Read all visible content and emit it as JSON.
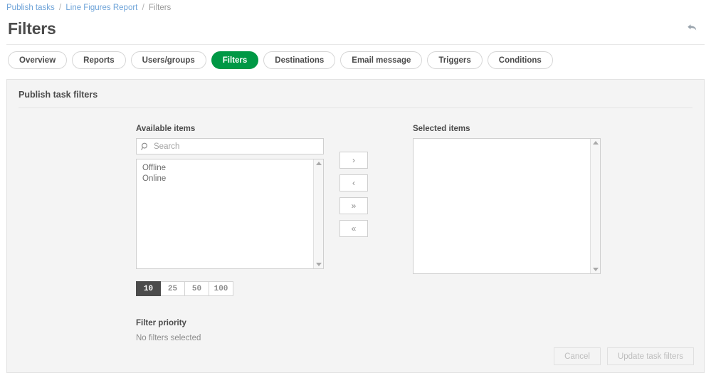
{
  "breadcrumb": {
    "items": [
      {
        "label": "Publish tasks",
        "type": "link"
      },
      {
        "label": "Line Figures Report",
        "type": "link"
      },
      {
        "label": "Filters",
        "type": "current"
      }
    ],
    "separator": "/"
  },
  "header": {
    "title": "Filters",
    "back_icon": "back-arrow-icon"
  },
  "tabs": [
    {
      "label": "Overview",
      "active": false
    },
    {
      "label": "Reports",
      "active": false
    },
    {
      "label": "Users/groups",
      "active": false
    },
    {
      "label": "Filters",
      "active": true
    },
    {
      "label": "Destinations",
      "active": false
    },
    {
      "label": "Email message",
      "active": false
    },
    {
      "label": "Triggers",
      "active": false
    },
    {
      "label": "Conditions",
      "active": false
    }
  ],
  "card": {
    "title": "Publish task filters"
  },
  "available": {
    "label": "Available items",
    "search_placeholder": "Search",
    "search_value": "",
    "search_icon": "search-icon",
    "items": [
      "Offline",
      "Online"
    ]
  },
  "selected": {
    "label": "Selected items",
    "items": []
  },
  "transfer_buttons": [
    {
      "glyph": "›",
      "name": "move-right-button"
    },
    {
      "glyph": "‹",
      "name": "move-left-button"
    },
    {
      "glyph": "»",
      "name": "move-all-right-button"
    },
    {
      "glyph": "«",
      "name": "move-all-left-button"
    }
  ],
  "page_sizes": [
    {
      "label": "10",
      "active": true
    },
    {
      "label": "25",
      "active": false
    },
    {
      "label": "50",
      "active": false
    },
    {
      "label": "100",
      "active": false
    }
  ],
  "priority": {
    "title": "Filter priority",
    "empty_text": "No filters selected"
  },
  "actions": {
    "cancel_label": "Cancel",
    "update_label": "Update task filters"
  },
  "colors": {
    "accent_green": "#009845",
    "link_blue": "#6ea3d8",
    "text_dark": "#4b4b4b",
    "text_muted": "#8c8c8c",
    "card_bg": "#f4f4f4",
    "active_pagesize_bg": "#4b4b4b"
  }
}
